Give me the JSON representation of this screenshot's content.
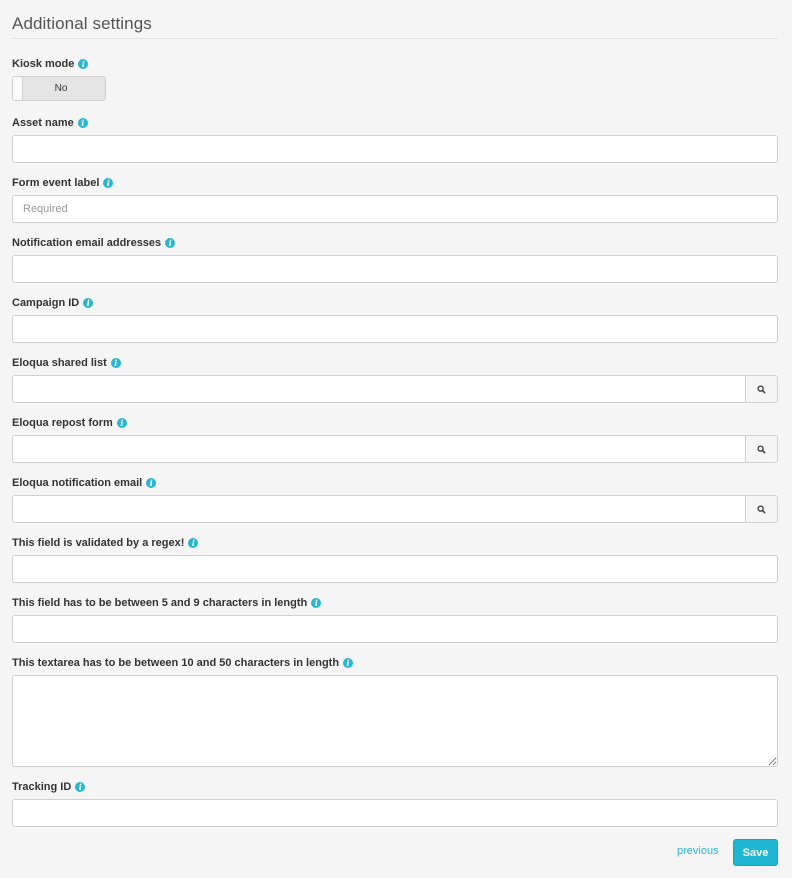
{
  "section_title": "Additional settings",
  "info_glyph": "i",
  "kiosk": {
    "label": "Kiosk mode",
    "value": "No"
  },
  "fields": {
    "asset_name": {
      "label": "Asset name",
      "value": "",
      "placeholder": ""
    },
    "form_event_label": {
      "label": "Form event label",
      "value": "",
      "placeholder": "Required"
    },
    "notification_emails": {
      "label": "Notification email addresses",
      "value": "",
      "placeholder": ""
    },
    "campaign_id": {
      "label": "Campaign ID",
      "value": "",
      "placeholder": ""
    },
    "eloqua_shared_list": {
      "label": "Eloqua shared list",
      "value": "",
      "placeholder": ""
    },
    "eloqua_repost_form": {
      "label": "Eloqua repost form",
      "value": "",
      "placeholder": ""
    },
    "eloqua_notification_email": {
      "label": "Eloqua notification email",
      "value": "",
      "placeholder": ""
    },
    "regex_field": {
      "label": "This field is validated by a regex!",
      "value": "",
      "placeholder": ""
    },
    "length_field": {
      "label": "This field has to be between 5 and 9 characters in length",
      "value": "",
      "placeholder": ""
    },
    "length_textarea": {
      "label": "This textarea has to be between 10 and 50 characters in length",
      "value": "",
      "placeholder": ""
    },
    "tracking_id": {
      "label": "Tracking ID",
      "value": "",
      "placeholder": ""
    }
  },
  "actions": {
    "previous_label": "previous",
    "save_label": "Save"
  },
  "colors": {
    "accent": "#1fb6d3",
    "info_icon": "#29b6d1",
    "background": "#f5f5f5",
    "border": "#cfcfcf"
  },
  "icons": {
    "info": "info-icon",
    "search": "search-icon"
  }
}
